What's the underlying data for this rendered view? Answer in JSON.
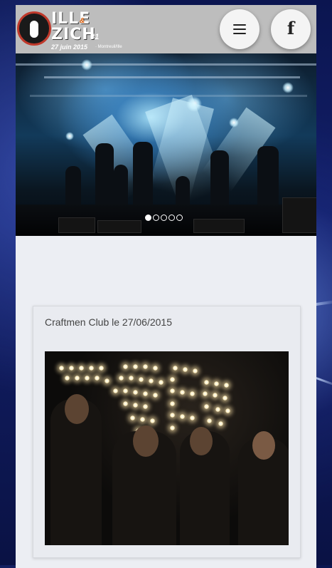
{
  "header": {
    "logo": {
      "word1": "ILLE",
      "amp": "&",
      "word2": "ZICH",
      "edition": "#1",
      "date": "27 juin 2015",
      "place": "· Montreuil/Ille"
    },
    "menu_icon": "hamburger-menu-icon",
    "facebook_icon": "facebook-icon"
  },
  "slider": {
    "slide_count": 5,
    "active_slide": 1
  },
  "card": {
    "title": "Craftmen Club le 27/06/2015"
  },
  "colors": {
    "page_background": "#eceef3",
    "header_background": "#bdbdbd",
    "logo_accent": "#c0392b"
  }
}
